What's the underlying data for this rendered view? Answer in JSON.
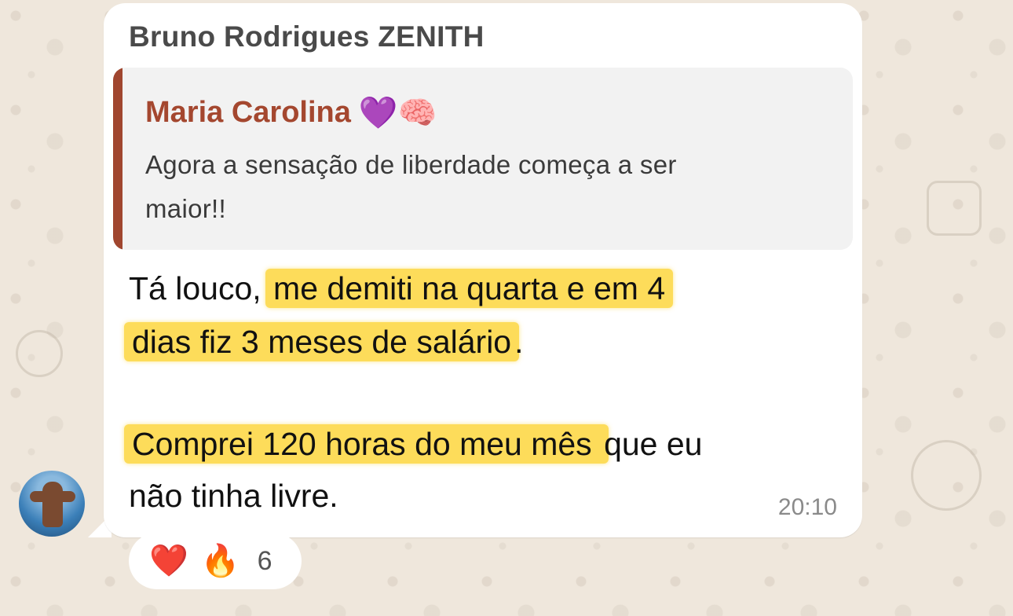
{
  "message": {
    "sender": "Bruno Rodrigues ZENITH",
    "quoted": {
      "author": "Maria Carolina",
      "author_emojis": "💜🧠",
      "text_line1": "Agora a sensação de liberdade começa a ser",
      "text_line2": "maior!!"
    },
    "body": {
      "l1_plain": "Tá louco, ",
      "l1_hl": "me demiti na quarta e em 4",
      "l2_hl": "dias fiz 3 meses de salário",
      "l2_plain": ".",
      "l3_hl": "Comprei 120 horas do meu mês ",
      "l3_plain": "que eu",
      "l4_plain": "não tinha livre."
    },
    "time": "20:10"
  },
  "reactions": {
    "heart": "❤️",
    "fire": "🔥",
    "count": "6"
  },
  "colors": {
    "bubble": "#ffffff",
    "quote_accent": "#a0462f",
    "highlight": "#fddc5a",
    "wallpaper": "#efe7dc"
  }
}
